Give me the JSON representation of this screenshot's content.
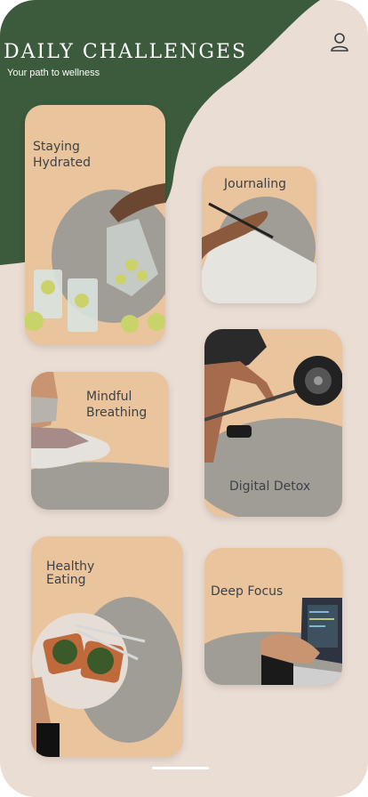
{
  "header": {
    "title": "DAILY CHALLENGES",
    "subtitle": "Your path to wellness",
    "profile_icon": "user-icon"
  },
  "colors": {
    "background": "#eaddd4",
    "header_shape": "#3c5a3c",
    "card": "#e9c49c",
    "blob": "#a09d97",
    "label": "#3e4247"
  },
  "challenges": [
    {
      "label": "Staying\nHydrated",
      "image": "pouring water into glasses with lime slices"
    },
    {
      "label": "Journaling",
      "image": "hand writing in notebook"
    },
    {
      "label": "Mindful\nBreathing",
      "image": "seated meditation pose"
    },
    {
      "label": "Digital Detox",
      "image": "barbell deadlift"
    },
    {
      "label": "Healthy\nEating",
      "image": "plate of avocado toast"
    },
    {
      "label": "Deep Focus",
      "image": "hands typing on laptop"
    }
  ]
}
